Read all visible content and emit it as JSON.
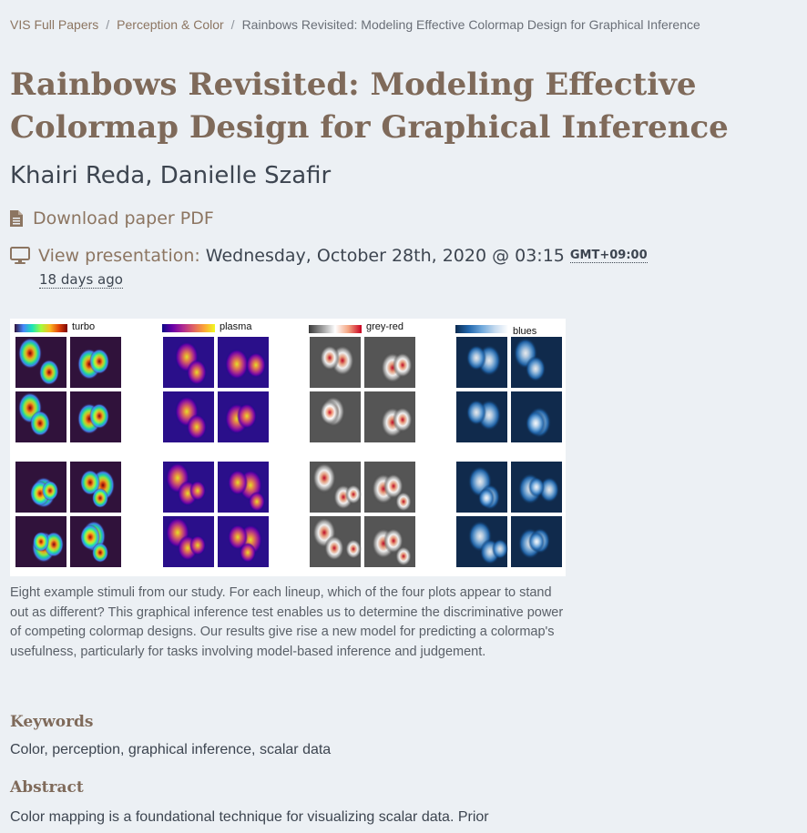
{
  "breadcrumb": {
    "items": [
      "VIS Full Papers",
      "Perception & Color",
      "Rainbows Revisited: Modeling Effective Colormap Design for Graphical Inference"
    ],
    "separator": "/"
  },
  "paper": {
    "title": "Rainbows Revisited: Modeling Effective Colormap Design for Graphical Inference",
    "authors": "Khairi Reda, Danielle Szafir"
  },
  "links": {
    "pdf_label": "Download paper PDF",
    "presentation_label": "View presentation:",
    "presentation_time": "Wednesday, October 28th, 2020 @ 03:15",
    "timezone": "GMT+09:00",
    "relative_time": "18 days ago"
  },
  "icons": {
    "pdf": "file-document-icon",
    "presentation": "monitor-icon"
  },
  "figure": {
    "colormaps": [
      {
        "name": "turbo",
        "gradient": [
          "#30123b",
          "#4686fb",
          "#1ae4b6",
          "#a2fc3c",
          "#fabb21",
          "#e4460a",
          "#7a0403"
        ],
        "bg": "#30123b"
      },
      {
        "name": "plasma",
        "gradient": [
          "#0d0887",
          "#6a00a8",
          "#b12a90",
          "#e16462",
          "#fca636",
          "#f0f921"
        ],
        "bg": "#2a0f8a"
      },
      {
        "name": "grey-red",
        "gradient": [
          "#3a3a3a",
          "#9a9a9a",
          "#ffffff",
          "#f4a582",
          "#ca0020"
        ],
        "bg": "#555555"
      },
      {
        "name": "blues",
        "gradient": [
          "#0b2a4f",
          "#2166ac",
          "#6fa8dc",
          "#c6dbef",
          "#ffffff"
        ],
        "bg": "#102a4c"
      }
    ],
    "caption": "Eight example stimuli from our study. For each lineup, which of the four plots appear to stand out as different? This graphical inference test enables us to determine the discriminative power of competing colormap designs. Our results give rise a new model for predicting a colormap's usefulness, particularly for tasks involving model-based inference and judgement."
  },
  "keywords": {
    "heading": "Keywords",
    "text": "Color, perception, graphical inference, scalar data"
  },
  "abstract": {
    "heading": "Abstract",
    "text": "Color mapping is a foundational technique for visualizing scalar data. Prior"
  },
  "colors": {
    "background": "#ecf0f4",
    "accent": "#8c7561",
    "title": "#7f6a5a",
    "text": "#3d4550"
  }
}
